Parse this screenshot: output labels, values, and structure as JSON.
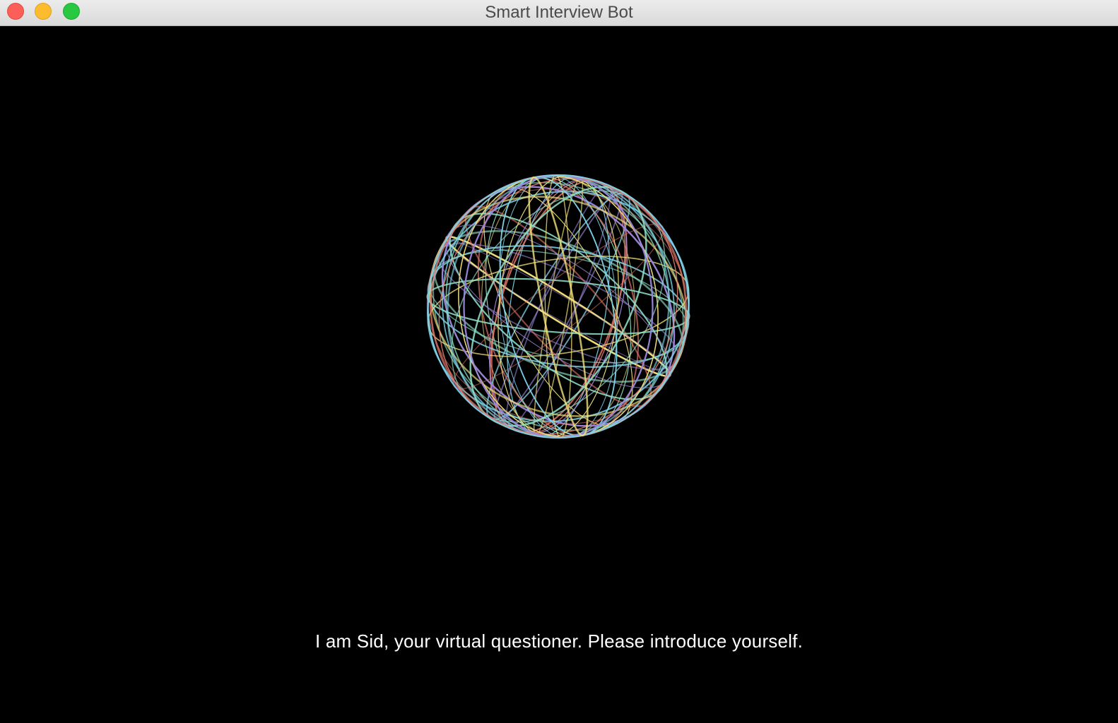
{
  "window": {
    "title": "Smart Interview Bot"
  },
  "controls": {
    "close_icon": "close-icon",
    "minimize_icon": "minimize-icon",
    "maximize_icon": "maximize-icon"
  },
  "orb": {
    "icon": "wireframe-sphere-animation",
    "colors": [
      "#f1e07a",
      "#8fe0c8",
      "#e0776a",
      "#9a86d8",
      "#7fd3e8"
    ]
  },
  "bot": {
    "message": "I am Sid, your virtual questioner. Please introduce yourself."
  }
}
